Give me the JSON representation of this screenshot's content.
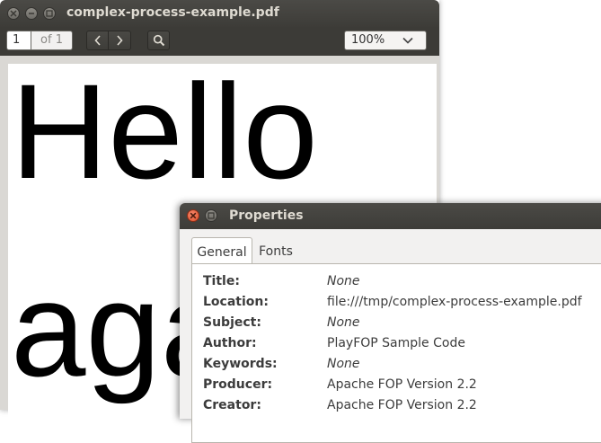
{
  "viewer": {
    "title": "complex-process-example.pdf",
    "page_current": "1",
    "page_total": "of 1",
    "zoom": "100%"
  },
  "document": {
    "line1": "Hello",
    "line2": "aga"
  },
  "dialog": {
    "title": "Properties",
    "tabs": [
      {
        "label": "General",
        "active": true
      },
      {
        "label": "Fonts",
        "active": false
      }
    ],
    "fields": [
      {
        "label": "Title:",
        "value": "None"
      },
      {
        "label": "Location:",
        "value": "file:///tmp/complex-process-example.pdf"
      },
      {
        "label": "Subject:",
        "value": "None"
      },
      {
        "label": "Author:",
        "value": "PlayFOP Sample Code"
      },
      {
        "label": "Keywords:",
        "value": "None"
      },
      {
        "label": "Producer:",
        "value": "Apache FOP Version 2.2"
      },
      {
        "label": "Creator:",
        "value": "Apache FOP Version 2.2"
      }
    ]
  },
  "icons": {
    "close": "close-icon",
    "minimize": "minimize-icon",
    "maximize": "maximize-icon",
    "prev": "chevron-left-icon",
    "next": "chevron-right-icon",
    "search": "search-icon",
    "dropdown": "chevron-down-icon"
  },
  "colors": {
    "titlebar": "#3c3b37",
    "close_accent": "#e0512c",
    "dialog_bg": "#f2f1f0"
  }
}
